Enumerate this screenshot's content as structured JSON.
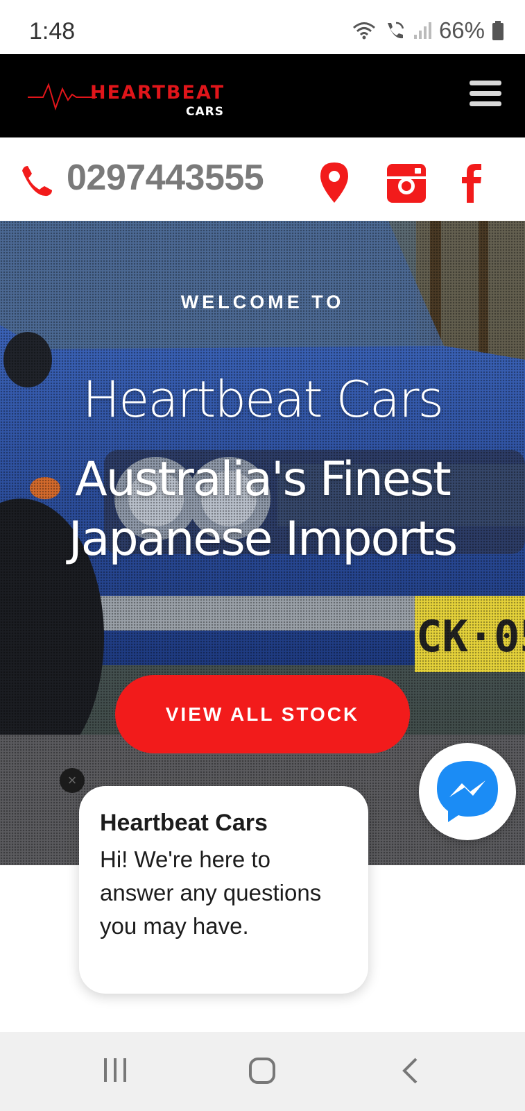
{
  "status_bar": {
    "time": "1:48",
    "battery": "66%",
    "icons": [
      "wifi-icon",
      "wifi-calling-icon",
      "signal-icon",
      "battery-icon"
    ]
  },
  "header": {
    "logo_word": "HEARTBEAT",
    "logo_sub": "CARS",
    "menu_icon": "hamburger-menu-icon"
  },
  "contact": {
    "phone": "0297443555",
    "icons": [
      "phone-icon",
      "location-pin-icon",
      "instagram-icon",
      "facebook-icon"
    ]
  },
  "hero": {
    "kicker": "WELCOME TO",
    "title": "Heartbeat Cars",
    "subtitle": "Australia's Finest Japanese Imports",
    "cta_label": "VIEW ALL STOCK"
  },
  "chat": {
    "name": "Heartbeat Cars",
    "message": "Hi! We're here to answer any questions you may have.",
    "close_label": "×"
  },
  "colors": {
    "brand_red": "#f21b1b",
    "header_bg": "#000000",
    "phone_text": "#7a7a7a",
    "messenger_blue": "#1b8cf5"
  }
}
